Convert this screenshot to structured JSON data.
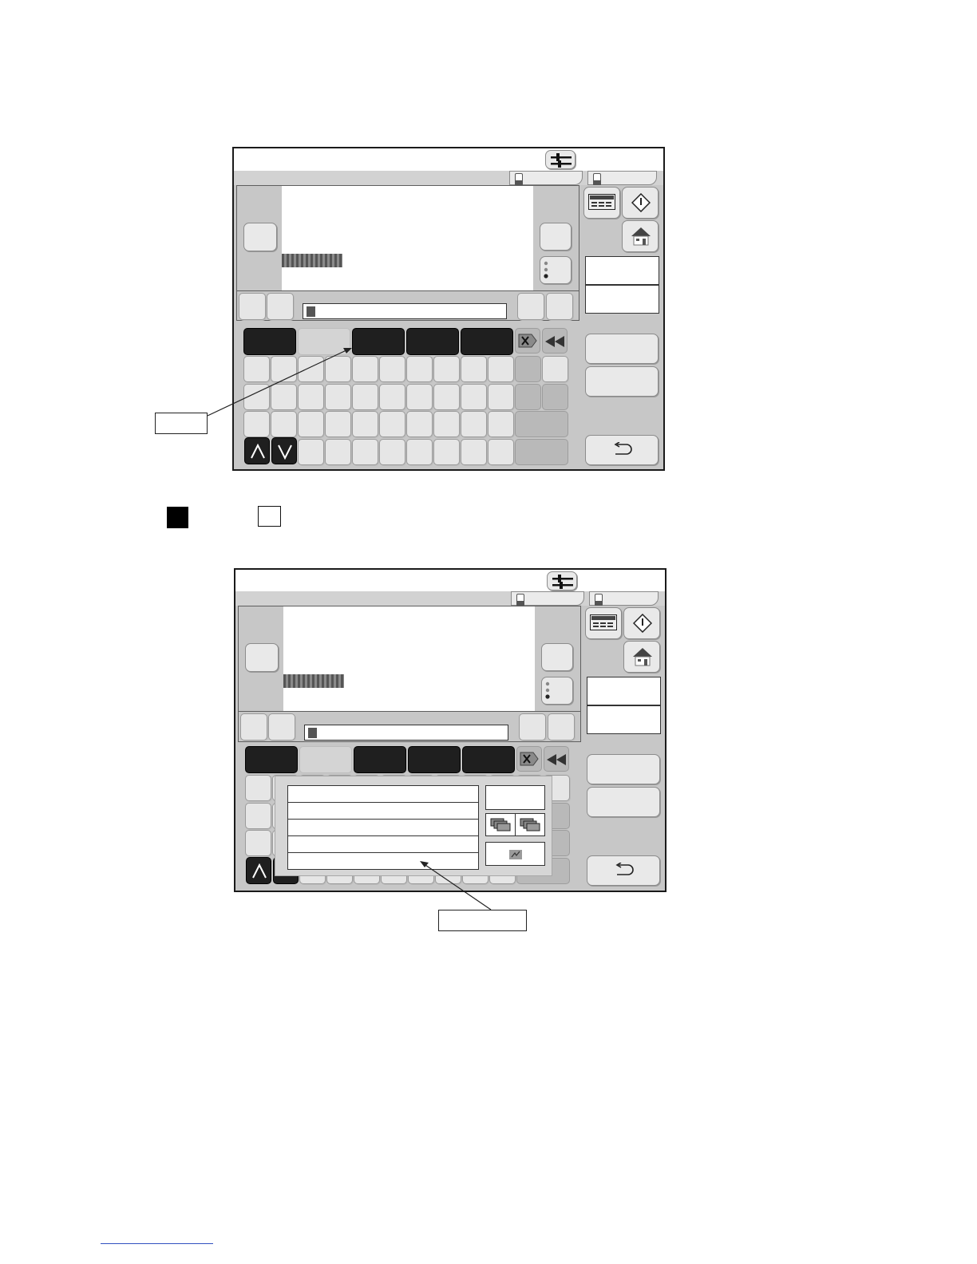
{
  "screens": [
    {
      "id": "screen-top",
      "state": "keyboard"
    },
    {
      "id": "screen-bottom",
      "state": "list-popup"
    }
  ],
  "icons": {
    "settings": "sliders-icon",
    "panel": "display-panel-icon",
    "start": "diamond-start-icon",
    "home": "house-icon",
    "delete": "delete-icon",
    "rewind": "rewind-icon",
    "back": "return-arrow-icon",
    "up": "chevron-up-icon",
    "down": "chevron-down-icon",
    "copy": "copy-stack-icon",
    "edit": "edit-icon"
  },
  "colors": {
    "frame": "#1a1a1a",
    "panel": "#c7c7c7",
    "dark_key": "#1f1f1f",
    "key": "#e6e6e6"
  },
  "legend": {
    "filled": "",
    "outlined": ""
  },
  "callouts": {
    "top": "",
    "bottom": ""
  }
}
